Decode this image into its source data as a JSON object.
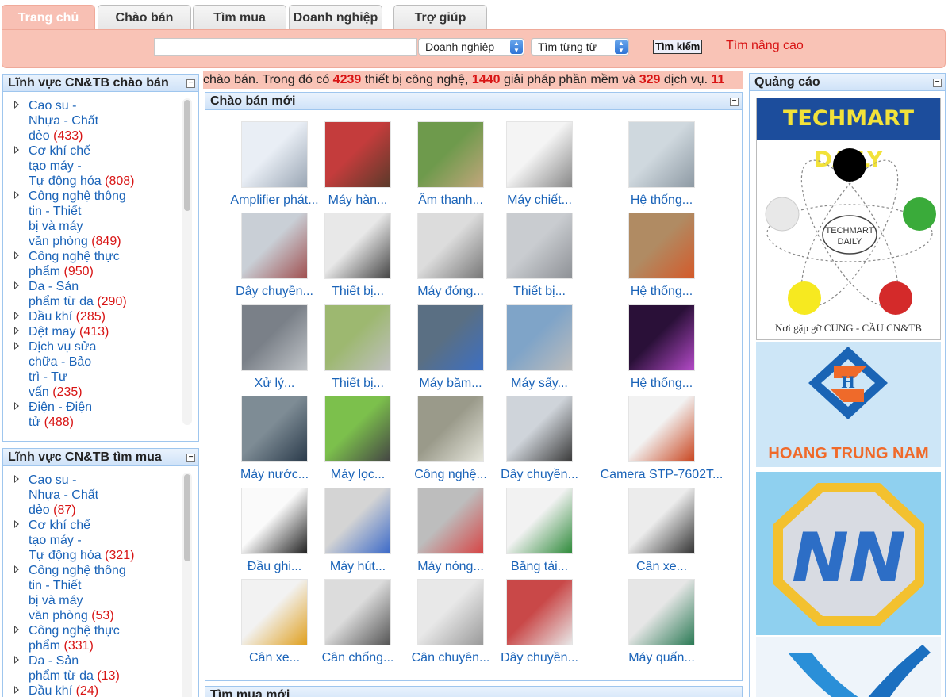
{
  "nav": {
    "tabs": [
      {
        "label": "Trang chủ",
        "active": true
      },
      {
        "label": "Chào bán",
        "active": false
      },
      {
        "label": "Tìm mua",
        "active": false
      },
      {
        "label": "Doanh nghiệp",
        "active": false
      },
      {
        "label": "Trợ giúp",
        "active": false
      }
    ]
  },
  "search": {
    "query": "",
    "type_select": "Doanh nghiệp",
    "mode_select": "Tìm từng từ",
    "button_label": "Tìm kiếm",
    "advanced_label": "Tìm nâng cao"
  },
  "ticker": {
    "prefix": "chào bán. Trong đó có ",
    "count1": "4239",
    "mid1": " thiết bị công nghệ, ",
    "count2": "1440",
    "mid2": " giải pháp phần mềm và ",
    "count3": "329",
    "mid3": " dịch vụ. ",
    "tail": "11"
  },
  "sell_categories": {
    "title": "Lĩnh vực CN&TB chào bán",
    "items": [
      {
        "lines": [
          "Cao su -",
          "Nhựa - Chất",
          "dẻo"
        ],
        "count": "(433)"
      },
      {
        "lines": [
          "Cơ khí chế",
          "tạo máy -",
          "Tự động hóa"
        ],
        "count": "(808)"
      },
      {
        "lines": [
          "Công nghệ thông",
          "tin - Thiết",
          "bị và máy",
          "văn phòng"
        ],
        "count": "(849)"
      },
      {
        "lines": [
          "Công nghệ thực",
          "phẩm"
        ],
        "count": "(950)"
      },
      {
        "lines": [
          "Da - Sản",
          "phẩm từ da"
        ],
        "count": "(290)"
      },
      {
        "lines": [
          "Dầu khí"
        ],
        "count": "(285)"
      },
      {
        "lines": [
          "Dệt may"
        ],
        "count": "(413)"
      },
      {
        "lines": [
          "Dịch vụ sửa",
          "chữa - Bảo",
          "trì - Tư",
          "vấn"
        ],
        "count": "(235)"
      },
      {
        "lines": [
          "Điện - Điện",
          "tử"
        ],
        "count": "(488)"
      }
    ]
  },
  "buy_categories": {
    "title": "Lĩnh vực CN&TB tìm mua",
    "items": [
      {
        "lines": [
          "Cao su -",
          "Nhựa - Chất",
          "dẻo"
        ],
        "count": "(87)"
      },
      {
        "lines": [
          "Cơ khí chế",
          "tạo máy -",
          "Tự động hóa"
        ],
        "count": "(321)"
      },
      {
        "lines": [
          "Công nghệ thông",
          "tin - Thiết",
          "bị và máy",
          "văn phòng"
        ],
        "count": "(53)"
      },
      {
        "lines": [
          "Công nghệ thực",
          "phẩm"
        ],
        "count": "(331)"
      },
      {
        "lines": [
          "Da - Sản",
          "phẩm từ da"
        ],
        "count": "(13)"
      },
      {
        "lines": [
          "Dầu khí"
        ],
        "count": "(24)"
      }
    ]
  },
  "new_offers": {
    "title": "Chào bán mới",
    "products": [
      "Amplifier phát...",
      "Máy hàn...",
      "Âm thanh...",
      "Máy chiết...",
      "Hệ thống...",
      "Dây chuyền...",
      "Thiết bị...",
      "Máy đóng...",
      "Thiết bị...",
      "Hệ thống...",
      "Xử lý...",
      "Thiết bị...",
      "Máy băm...",
      "Máy sấy...",
      "Hệ thống...",
      "Máy nước...",
      "Máy lọc...",
      "Công nghệ...",
      "Dây chuyền...",
      "Camera STP-7602T...",
      "Đầu ghi...",
      "Máy hút...",
      "Máy nóng...",
      "Băng tải...",
      "Cân xe...",
      "Cân xe...",
      "Cân chống...",
      "Cân chuyên...",
      "Dây chuyền...",
      "Máy quấn..."
    ]
  },
  "new_requests": {
    "title": "Tìm mua mới"
  },
  "ads": {
    "title": "Quảng cáo",
    "techmart_title": "TECHMART DAILY",
    "techmart_center_line1": "TECHMART",
    "techmart_center_line2": "DAILY",
    "techmart_slogan": "Nơi gặp gỡ CUNG - CẦU CN&TB",
    "htn_name": "HOANG TRUNG NAM",
    "nn_logo": "NN"
  }
}
